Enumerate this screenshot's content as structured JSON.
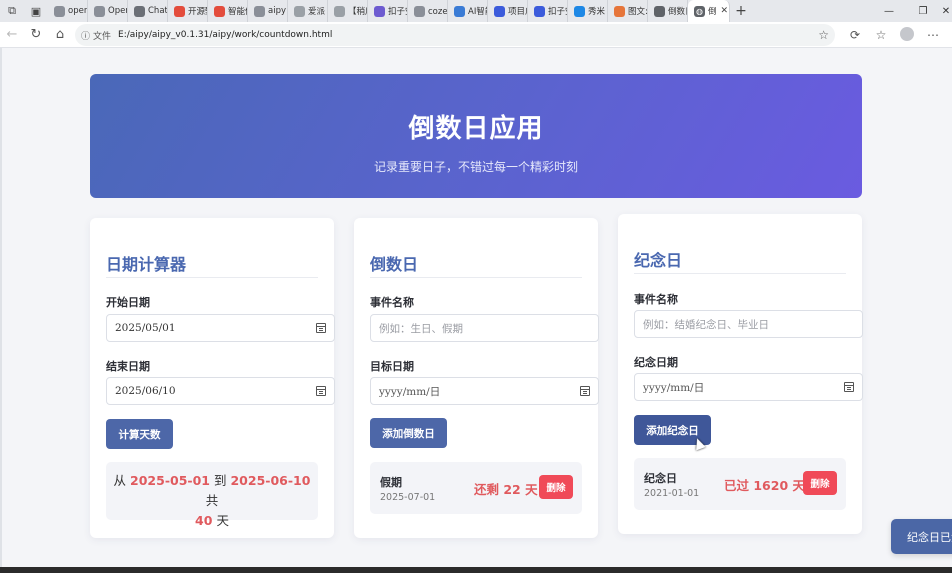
{
  "browser": {
    "tabs": [
      {
        "label": "opena",
        "color": "#8a8f98"
      },
      {
        "label": "Open/",
        "color": "#8a8f98"
      },
      {
        "label": "ChatG",
        "color": "#6b6f76"
      },
      {
        "label": "开源甄",
        "color": "#e34c3c"
      },
      {
        "label": "智能体",
        "color": "#e34c3c"
      },
      {
        "label": "aipy",
        "color": "#8a8f98"
      },
      {
        "label": "爱派",
        "color": "#9aa0a6"
      },
      {
        "label": "【稍后",
        "color": "#9aa0a6"
      },
      {
        "label": "扣子空",
        "color": "#6d5bd0"
      },
      {
        "label": "coze工",
        "color": "#8a8f98"
      },
      {
        "label": "AI智能",
        "color": "#3a7bd5"
      },
      {
        "label": "项目启",
        "color": "#3b5bdb"
      },
      {
        "label": "扣子空",
        "color": "#3b5bdb"
      },
      {
        "label": "秀米",
        "color": "#1e88e5"
      },
      {
        "label": "图文:",
        "color": "#e6753a"
      },
      {
        "label": "倒数日",
        "color": "#5f6368"
      }
    ],
    "active_tab": {
      "label": "倒"
    },
    "address": {
      "protocol": "文件",
      "url": "E:/aipy/aipy_v0.1.31/aipy/work/countdown.html"
    }
  },
  "hero": {
    "title": "倒数日应用",
    "subtitle": "记录重要日子，不错过每一个精彩时刻"
  },
  "calculator": {
    "title": "日期计算器",
    "start_label": "开始日期",
    "start_value": "2025/05/01",
    "end_label": "结束日期",
    "end_value": "2025/06/10",
    "button": "计算天数",
    "result": {
      "prefix": "从",
      "start": "2025-05-01",
      "to": "到",
      "end": "2025-06-10",
      "total": "共",
      "days": "40",
      "unit": "天"
    }
  },
  "countdown": {
    "title": "倒数日",
    "name_label": "事件名称",
    "name_placeholder": "例如：生日、假期",
    "date_label": "目标日期",
    "date_placeholder": "yyyy/mm/日",
    "button": "添加倒数日",
    "event": {
      "name": "假期",
      "date": "2025-07-01",
      "count": "还剩 22 天",
      "delete": "删除"
    }
  },
  "anniversary": {
    "title": "纪念日",
    "name_label": "事件名称",
    "name_placeholder": "例如：结婚纪念日、毕业日",
    "date_label": "纪念日期",
    "date_placeholder": "yyyy/mm/日",
    "button": "添加纪念日",
    "event": {
      "name": "纪念日",
      "date": "2021-01-01",
      "count": "已过 1620 天",
      "delete": "删除"
    }
  },
  "toast": {
    "text": "纪念日已添"
  }
}
